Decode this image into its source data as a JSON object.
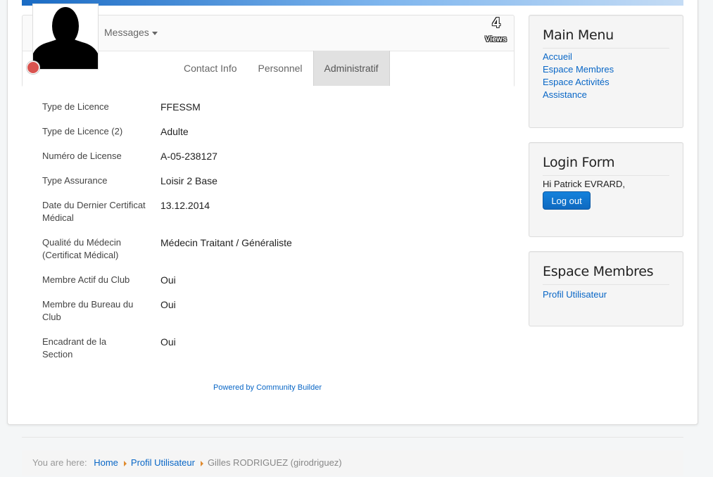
{
  "profile": {
    "messages_label": "Messages",
    "views_count": "4",
    "views_label": "Views",
    "status_color": "#d9534f"
  },
  "tabs": [
    {
      "label": "Contact Info",
      "active": false
    },
    {
      "label": "Personnel",
      "active": false
    },
    {
      "label": "Administratif",
      "active": true
    }
  ],
  "fields": [
    {
      "label": "Type de Licence",
      "value": "FFESSM"
    },
    {
      "label": "Type de Licence (2)",
      "value": "Adulte"
    },
    {
      "label": "Numéro de License",
      "value": "A-05-238127"
    },
    {
      "label": "Type Assurance",
      "value": "Loisir 2 Base"
    },
    {
      "label": "Date du Dernier Certificat Médical",
      "value": "13.12.2014"
    },
    {
      "label": "Qualité du Médecin (Certificat Médical)",
      "value": "Médecin Traitant / Généraliste"
    },
    {
      "label": "Membre Actif du Club",
      "value": "Oui"
    },
    {
      "label": "Membre du Bureau du Club",
      "value": "Oui"
    },
    {
      "label": "Encadrant de la Section",
      "value": "Oui"
    }
  ],
  "powered_by": "Powered by Community Builder",
  "main_menu": {
    "title": "Main Menu",
    "items": [
      "Accueil",
      "Espace Membres",
      "Espace Activités",
      "Assistance"
    ]
  },
  "login_form": {
    "title": "Login Form",
    "greeting": "Hi Patrick EVRARD,",
    "logout_label": "Log out"
  },
  "espace_membres": {
    "title": "Espace Membres",
    "items": [
      "Profil Utilisateur"
    ]
  },
  "breadcrumb": {
    "label": "You are here:",
    "items": [
      "Home",
      "Profil Utilisateur"
    ],
    "current": "Gilles RODRIGUEZ (girodriguez)"
  },
  "colors": {
    "link": "#0866c6",
    "button": "#1582dc",
    "breadcrumb_divider": "#e08b2f"
  }
}
